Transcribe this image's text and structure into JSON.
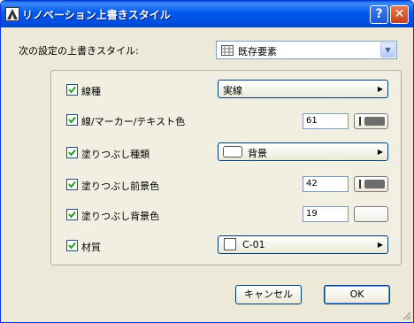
{
  "window": {
    "title": "リノベーション上書きスタイル"
  },
  "header": {
    "style_label": "次の設定の上書きスタイル:",
    "style_value": "既存要素"
  },
  "rows": [
    {
      "label": "線種",
      "checked": true,
      "control": "selector",
      "value": "実線"
    },
    {
      "label": "線/マーカー/テキスト色",
      "checked": true,
      "control": "pen",
      "value": "61"
    },
    {
      "label": "塗りつぶし種類",
      "checked": true,
      "control": "selector",
      "value": "背景"
    },
    {
      "label": "塗りつぶし前景色",
      "checked": true,
      "control": "pen",
      "value": "42"
    },
    {
      "label": "塗りつぶし背景色",
      "checked": true,
      "control": "pen",
      "value": "19"
    },
    {
      "label": "材質",
      "checked": true,
      "control": "selector",
      "value": "C-01"
    }
  ],
  "buttons": {
    "cancel": "キャンセル",
    "ok": "OK"
  },
  "icons": {
    "app": "archicad-icon",
    "help": "help-icon",
    "close": "close-icon",
    "style": "grid-icon",
    "dropdown": "chevron-down-icon",
    "arrow": "arrow-right-icon"
  },
  "colors": {
    "titlebar": "#0058ee",
    "face": "#ece9d8",
    "pen_dark": "#6d6d6d"
  }
}
